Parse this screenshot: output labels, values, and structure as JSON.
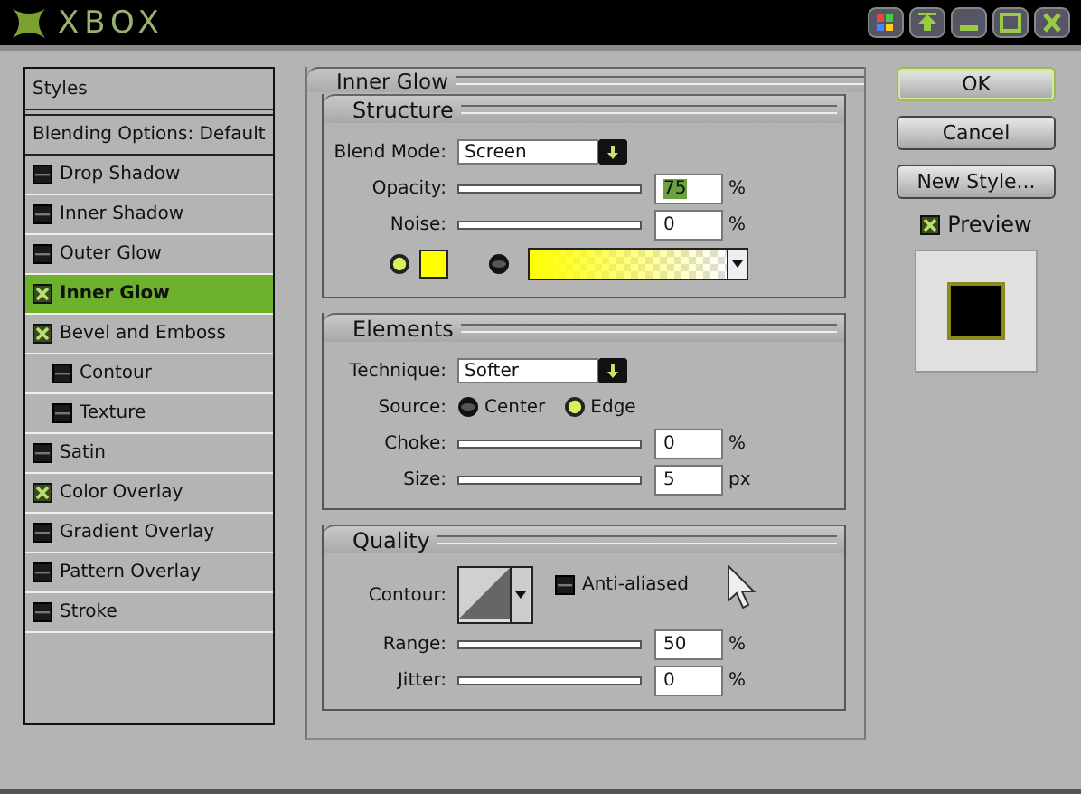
{
  "window": {
    "title": "XBOX"
  },
  "styles_list": {
    "header": "Styles",
    "items": [
      {
        "label": "Blending Options: Default",
        "kind": "plain",
        "selected": false
      },
      {
        "label": "Drop Shadow",
        "kind": "effect",
        "checked": false,
        "selected": false
      },
      {
        "label": "Inner Shadow",
        "kind": "effect",
        "checked": false,
        "selected": false
      },
      {
        "label": "Outer Glow",
        "kind": "effect",
        "checked": false,
        "selected": false
      },
      {
        "label": "Inner Glow",
        "kind": "effect",
        "checked": true,
        "selected": true
      },
      {
        "label": "Bevel and Emboss",
        "kind": "effect",
        "checked": true,
        "selected": false,
        "children": [
          {
            "label": "Contour",
            "kind": "effect",
            "checked": false,
            "selected": false
          },
          {
            "label": "Texture",
            "kind": "effect",
            "checked": false,
            "selected": false
          }
        ]
      },
      {
        "label": "Satin",
        "kind": "effect",
        "checked": false,
        "selected": false
      },
      {
        "label": "Color Overlay",
        "kind": "effect",
        "checked": true,
        "selected": false
      },
      {
        "label": "Gradient Overlay",
        "kind": "effect",
        "checked": false,
        "selected": false
      },
      {
        "label": "Pattern Overlay",
        "kind": "effect",
        "checked": false,
        "selected": false
      },
      {
        "label": "Stroke",
        "kind": "effect",
        "checked": false,
        "selected": false
      }
    ]
  },
  "panel": {
    "title": "Inner Glow",
    "sections": [
      {
        "title": "Structure",
        "rows": [
          {
            "kind": "select",
            "label": "Blend Mode:",
            "value": "Screen"
          },
          {
            "kind": "slider",
            "label": "Opacity:",
            "value": "75",
            "unit": "%",
            "highlighted": true
          },
          {
            "kind": "slider",
            "label": "Noise:",
            "value": "0",
            "unit": "%",
            "highlighted": false
          },
          {
            "kind": "fill",
            "options": [
              {
                "kind": "color",
                "selected": true,
                "color": "#ffff00"
              },
              {
                "kind": "gradient",
                "selected": false,
                "color": "#ffff00"
              }
            ]
          }
        ]
      },
      {
        "title": "Elements",
        "rows": [
          {
            "kind": "select",
            "label": "Technique:",
            "value": "Softer"
          },
          {
            "kind": "radios",
            "label": "Source:",
            "options": [
              {
                "label": "Center",
                "selected": false
              },
              {
                "label": "Edge",
                "selected": true
              }
            ]
          },
          {
            "kind": "slider",
            "label": "Choke:",
            "value": "0",
            "unit": "%",
            "highlighted": false
          },
          {
            "kind": "slider",
            "label": "Size:",
            "value": "5",
            "unit": "px",
            "highlighted": false
          }
        ]
      },
      {
        "title": "Quality",
        "rows": [
          {
            "kind": "contour",
            "label": "Contour:",
            "checkbox": {
              "label": "Anti-aliased",
              "checked": false
            }
          },
          {
            "kind": "slider",
            "label": "Range:",
            "value": "50",
            "unit": "%",
            "highlighted": false
          },
          {
            "kind": "slider",
            "label": "Jitter:",
            "value": "0",
            "unit": "%",
            "highlighted": false
          }
        ]
      }
    ]
  },
  "buttons": [
    {
      "label": "OK",
      "default": true
    },
    {
      "label": "Cancel",
      "default": false
    },
    {
      "label": "New Style...",
      "default": false
    }
  ],
  "preview": {
    "label": "Preview",
    "checked": true
  }
}
